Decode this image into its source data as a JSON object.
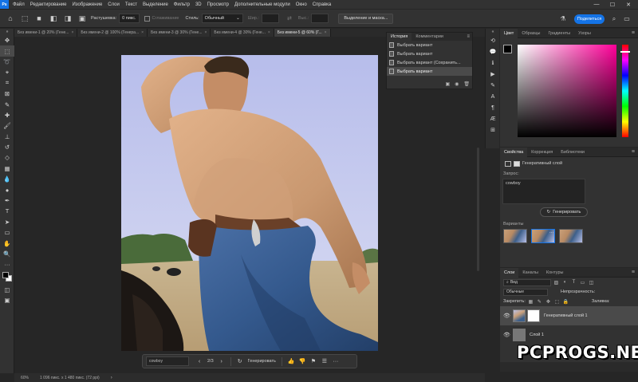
{
  "menubar": {
    "items": [
      "Файл",
      "Редактирование",
      "Изображение",
      "Слои",
      "Текст",
      "Выделение",
      "Фильтр",
      "3D",
      "Просмотр",
      "Дополнительные модули",
      "Окно",
      "Справка"
    ]
  },
  "options_bar": {
    "feather_label": "Растушевка:",
    "feather_value": "0 пикс.",
    "antialias_label": "Сглаживание",
    "style_label": "Стиль:",
    "style_value": "Обычный",
    "width_label": "Шир.:",
    "height_label": "Выс.:",
    "select_mask_button": "Выделение и маска...",
    "share_button": "Поделиться"
  },
  "tabs": [
    {
      "label": "Без имени-1 @ 20% (Гене...",
      "active": false
    },
    {
      "label": "Без имени-2 @ 100% (Генера...",
      "active": false
    },
    {
      "label": "Без имени-3 @ 30% (Гене...",
      "active": false
    },
    {
      "label": "Без имени-4 @ 30% (Гене...",
      "active": false
    },
    {
      "label": "Без имени-5 @ 60% (Г...",
      "active": true
    }
  ],
  "history_panel": {
    "tab_history": "История",
    "tab_comments": "Комментарии",
    "items": [
      "Выбрать вариант",
      "Выбрать вариант",
      "Выбрать вариант (Сохранить...",
      "Выбрать вариант"
    ],
    "selected_index": 3
  },
  "color_panel": {
    "tabs": [
      "Цвет",
      "Образцы",
      "Градиенты",
      "Узоры"
    ],
    "foreground": "#000000",
    "background": "#ffffff",
    "hue_color": "#ff0099"
  },
  "properties_panel": {
    "tabs": [
      "Свойства",
      "Коррекция",
      "Библиотеки"
    ],
    "layer_type": "Генеративный слой",
    "prompt_label": "Запрос:",
    "prompt_value": "cowboy",
    "generate_button": "Генерировать",
    "variants_label": "Варианты"
  },
  "layers_panel": {
    "tabs": [
      "Слои",
      "Каналы",
      "Контуры"
    ],
    "filter_label": "Вид",
    "blend_mode": "Обычные",
    "opacity_label": "Непрозрачность:",
    "lock_label": "Закрепить:",
    "fill_label": "Заливка:",
    "layers": [
      {
        "name": "Генеративный слой 1",
        "selected": true
      },
      {
        "name": "Слой 1",
        "selected": false
      }
    ]
  },
  "contextual_taskbar": {
    "prompt": "cowboy",
    "counter": "2/3",
    "generate_button": "Генерировать"
  },
  "status_bar": {
    "zoom": "60%",
    "doc_size": "1 096 пикс. x 1 480 пикс. (72 ppi)"
  },
  "watermark": "PCPROGS.NET"
}
